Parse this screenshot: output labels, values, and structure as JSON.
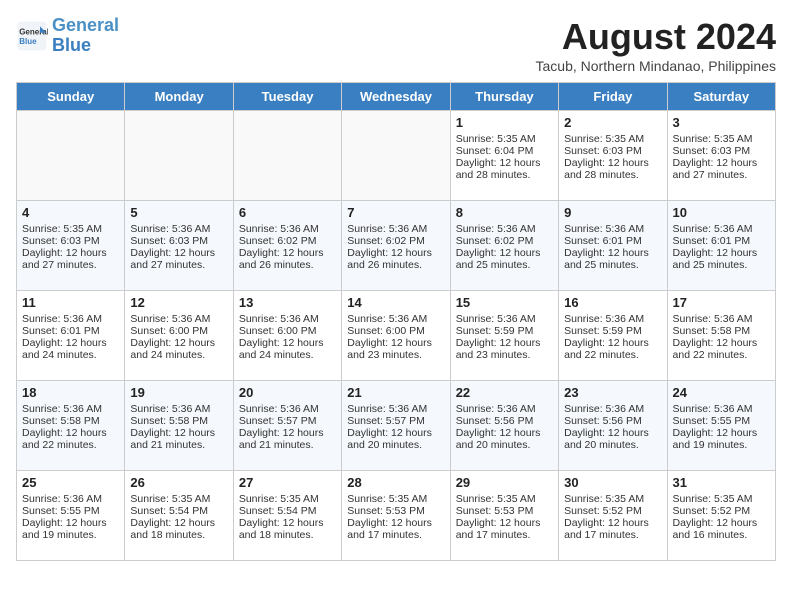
{
  "header": {
    "logo_line1": "General",
    "logo_line2": "Blue",
    "month_year": "August 2024",
    "location": "Tacub, Northern Mindanao, Philippines"
  },
  "days_of_week": [
    "Sunday",
    "Monday",
    "Tuesday",
    "Wednesday",
    "Thursday",
    "Friday",
    "Saturday"
  ],
  "weeks": [
    [
      {
        "day": "",
        "content": ""
      },
      {
        "day": "",
        "content": ""
      },
      {
        "day": "",
        "content": ""
      },
      {
        "day": "",
        "content": ""
      },
      {
        "day": "1",
        "content": "Sunrise: 5:35 AM\nSunset: 6:04 PM\nDaylight: 12 hours\nand 28 minutes."
      },
      {
        "day": "2",
        "content": "Sunrise: 5:35 AM\nSunset: 6:03 PM\nDaylight: 12 hours\nand 28 minutes."
      },
      {
        "day": "3",
        "content": "Sunrise: 5:35 AM\nSunset: 6:03 PM\nDaylight: 12 hours\nand 27 minutes."
      }
    ],
    [
      {
        "day": "4",
        "content": "Sunrise: 5:35 AM\nSunset: 6:03 PM\nDaylight: 12 hours\nand 27 minutes."
      },
      {
        "day": "5",
        "content": "Sunrise: 5:36 AM\nSunset: 6:03 PM\nDaylight: 12 hours\nand 27 minutes."
      },
      {
        "day": "6",
        "content": "Sunrise: 5:36 AM\nSunset: 6:02 PM\nDaylight: 12 hours\nand 26 minutes."
      },
      {
        "day": "7",
        "content": "Sunrise: 5:36 AM\nSunset: 6:02 PM\nDaylight: 12 hours\nand 26 minutes."
      },
      {
        "day": "8",
        "content": "Sunrise: 5:36 AM\nSunset: 6:02 PM\nDaylight: 12 hours\nand 25 minutes."
      },
      {
        "day": "9",
        "content": "Sunrise: 5:36 AM\nSunset: 6:01 PM\nDaylight: 12 hours\nand 25 minutes."
      },
      {
        "day": "10",
        "content": "Sunrise: 5:36 AM\nSunset: 6:01 PM\nDaylight: 12 hours\nand 25 minutes."
      }
    ],
    [
      {
        "day": "11",
        "content": "Sunrise: 5:36 AM\nSunset: 6:01 PM\nDaylight: 12 hours\nand 24 minutes."
      },
      {
        "day": "12",
        "content": "Sunrise: 5:36 AM\nSunset: 6:00 PM\nDaylight: 12 hours\nand 24 minutes."
      },
      {
        "day": "13",
        "content": "Sunrise: 5:36 AM\nSunset: 6:00 PM\nDaylight: 12 hours\nand 24 minutes."
      },
      {
        "day": "14",
        "content": "Sunrise: 5:36 AM\nSunset: 6:00 PM\nDaylight: 12 hours\nand 23 minutes."
      },
      {
        "day": "15",
        "content": "Sunrise: 5:36 AM\nSunset: 5:59 PM\nDaylight: 12 hours\nand 23 minutes."
      },
      {
        "day": "16",
        "content": "Sunrise: 5:36 AM\nSunset: 5:59 PM\nDaylight: 12 hours\nand 22 minutes."
      },
      {
        "day": "17",
        "content": "Sunrise: 5:36 AM\nSunset: 5:58 PM\nDaylight: 12 hours\nand 22 minutes."
      }
    ],
    [
      {
        "day": "18",
        "content": "Sunrise: 5:36 AM\nSunset: 5:58 PM\nDaylight: 12 hours\nand 22 minutes."
      },
      {
        "day": "19",
        "content": "Sunrise: 5:36 AM\nSunset: 5:58 PM\nDaylight: 12 hours\nand 21 minutes."
      },
      {
        "day": "20",
        "content": "Sunrise: 5:36 AM\nSunset: 5:57 PM\nDaylight: 12 hours\nand 21 minutes."
      },
      {
        "day": "21",
        "content": "Sunrise: 5:36 AM\nSunset: 5:57 PM\nDaylight: 12 hours\nand 20 minutes."
      },
      {
        "day": "22",
        "content": "Sunrise: 5:36 AM\nSunset: 5:56 PM\nDaylight: 12 hours\nand 20 minutes."
      },
      {
        "day": "23",
        "content": "Sunrise: 5:36 AM\nSunset: 5:56 PM\nDaylight: 12 hours\nand 20 minutes."
      },
      {
        "day": "24",
        "content": "Sunrise: 5:36 AM\nSunset: 5:55 PM\nDaylight: 12 hours\nand 19 minutes."
      }
    ],
    [
      {
        "day": "25",
        "content": "Sunrise: 5:36 AM\nSunset: 5:55 PM\nDaylight: 12 hours\nand 19 minutes."
      },
      {
        "day": "26",
        "content": "Sunrise: 5:35 AM\nSunset: 5:54 PM\nDaylight: 12 hours\nand 18 minutes."
      },
      {
        "day": "27",
        "content": "Sunrise: 5:35 AM\nSunset: 5:54 PM\nDaylight: 12 hours\nand 18 minutes."
      },
      {
        "day": "28",
        "content": "Sunrise: 5:35 AM\nSunset: 5:53 PM\nDaylight: 12 hours\nand 17 minutes."
      },
      {
        "day": "29",
        "content": "Sunrise: 5:35 AM\nSunset: 5:53 PM\nDaylight: 12 hours\nand 17 minutes."
      },
      {
        "day": "30",
        "content": "Sunrise: 5:35 AM\nSunset: 5:52 PM\nDaylight: 12 hours\nand 17 minutes."
      },
      {
        "day": "31",
        "content": "Sunrise: 5:35 AM\nSunset: 5:52 PM\nDaylight: 12 hours\nand 16 minutes."
      }
    ]
  ]
}
